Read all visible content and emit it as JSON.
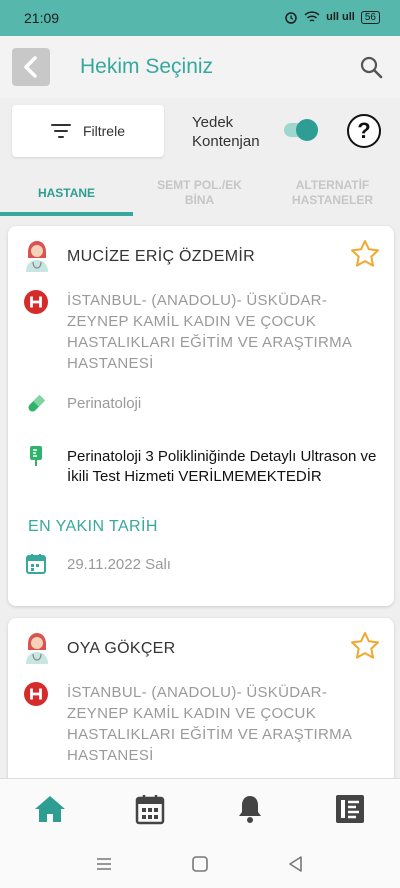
{
  "status_bar": {
    "time": "21:09",
    "signal_text": "ull ull",
    "battery": "56"
  },
  "header": {
    "title": "Hekim Seçiniz"
  },
  "filter": {
    "label": "Filtrele"
  },
  "reserve": {
    "label_line1": "Yedek",
    "label_line2": "Kontenjan",
    "enabled": true
  },
  "help": {
    "label": "?"
  },
  "tabs": [
    {
      "line1": "HASTANE",
      "line2": "",
      "active": true
    },
    {
      "line1": "SEMT POL./EK",
      "line2": "BİNA",
      "active": false
    },
    {
      "line1": "ALTERNATİF",
      "line2": "HASTANELER",
      "active": false
    }
  ],
  "cards": [
    {
      "doctor": "MUCİZE ERİÇ ÖZDEMİR",
      "hospital": "İSTANBUL- (ANADOLU)- ÜSKÜDAR-ZEYNEP KAMİL KADIN VE ÇOCUK HASTALIKLARI EĞİTİM VE ARAŞTIRMA HASTANESİ",
      "department": "Perinatoloji",
      "notice": "Perinatoloji 3 Polikliniğinde Detaylı Ultrason ve İkili Test Hizmeti VERİLMEMEKTEDİR",
      "nearest_label": "EN YAKIN TARİH",
      "date": "29.11.2022 Salı"
    },
    {
      "doctor": "OYA GÖKÇER",
      "hospital": "İSTANBUL- (ANADOLU)- ÜSKÜDAR-ZEYNEP KAMİL KADIN VE ÇOCUK HASTALIKLARI EĞİTİM VE ARAŞTIRMA HASTANESİ"
    }
  ],
  "colors": {
    "accent": "#38a89d",
    "status_bar": "#56b7ad",
    "hospital_icon": "#d62b2b",
    "pill_icon": "#2fb36b",
    "star": "#f0a92e"
  },
  "bottom_nav": [
    "home-icon",
    "calendar-icon",
    "bell-icon",
    "list-icon"
  ]
}
